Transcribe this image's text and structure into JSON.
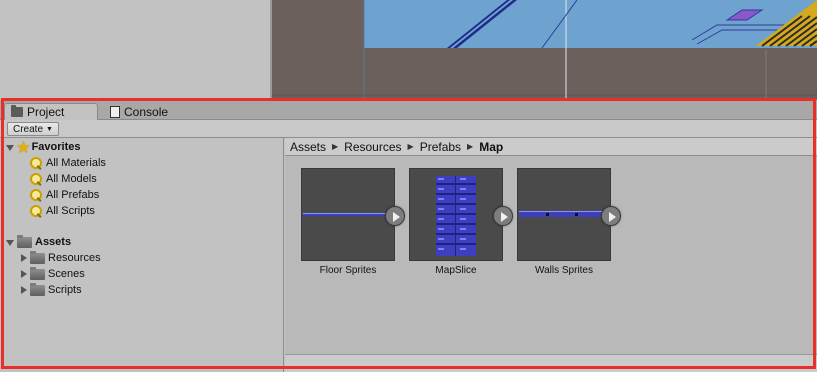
{
  "tabs": {
    "project_label": "Project",
    "console_label": "Console"
  },
  "toolbar": {
    "create_label": "Create"
  },
  "tree": {
    "favorites_label": "Favorites",
    "favorites_items": [
      "All Materials",
      "All Models",
      "All Prefabs",
      "All Scripts"
    ],
    "assets_label": "Assets",
    "assets_items": [
      "Resources",
      "Scenes",
      "Scripts"
    ]
  },
  "breadcrumb": {
    "items": [
      "Assets",
      "Resources",
      "Prefabs",
      "Map"
    ]
  },
  "assets": [
    {
      "label": "Floor Sprites",
      "icon": "sprite-strip-horizontal"
    },
    {
      "label": "MapSlice",
      "icon": "sprite-grid-vertical"
    },
    {
      "label": "Walls Sprites",
      "icon": "sprite-strip-horizontal"
    }
  ],
  "colors": {
    "highlight_outline": "#e8302a",
    "scene_sky": "#6fa3cf",
    "scene_ground": "#6b605c",
    "sprite_blue": "#3d3fbf"
  }
}
